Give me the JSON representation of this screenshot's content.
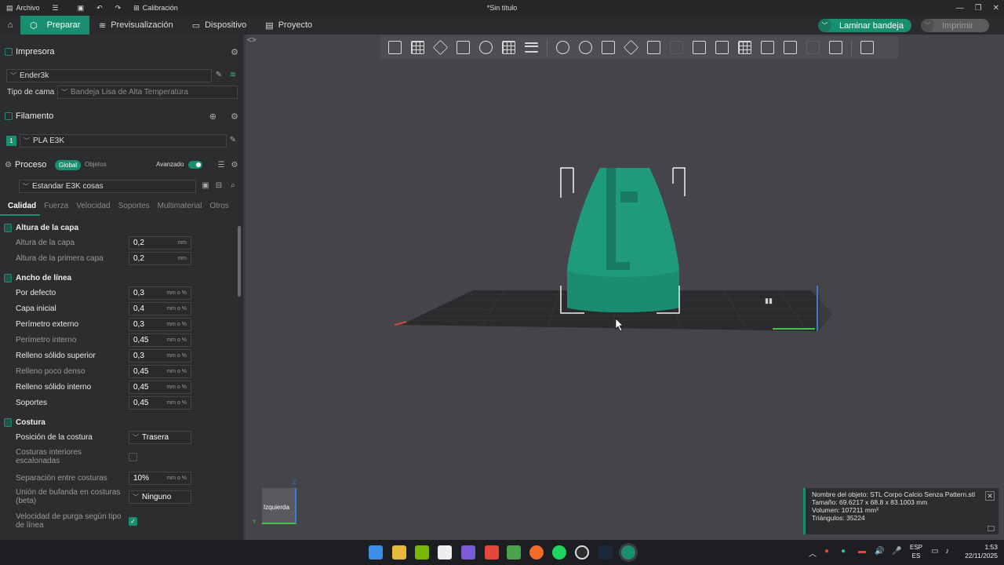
{
  "titlebar": {
    "menu_label": "Archivo",
    "calibration_label": "Calibración",
    "window_title": "*Sin título"
  },
  "nav": {
    "tabs": [
      {
        "label": "Preparar",
        "icon": "cube-icon",
        "active": true
      },
      {
        "label": "Previsualización",
        "icon": "layers-icon",
        "active": false
      },
      {
        "label": "Dispositivo",
        "icon": "monitor-icon",
        "active": false
      },
      {
        "label": "Proyecto",
        "icon": "document-icon",
        "active": false
      }
    ],
    "slice_button": "Laminar bandeja",
    "print_button": "Imprimir"
  },
  "printer": {
    "section_label": "Impresora",
    "printer_name": "Ender3k",
    "bed_type_label": "Tipo de cama",
    "bed_type_value": "Bandeja Lisa de Alta Temperatura"
  },
  "filament": {
    "section_label": "Filamento",
    "slot_number": "1",
    "filament_name": "PLA E3K"
  },
  "process": {
    "section_label": "Proceso",
    "global_label": "Global",
    "objects_label": "Objetos",
    "advanced_label": "Avanzado",
    "preset_name": "Estandar E3K cosas",
    "tabs": [
      "Calidad",
      "Fuerza",
      "Velocidad",
      "Soportes",
      "Multimaterial",
      "Otros"
    ]
  },
  "settings": {
    "groups": {
      "layer_height": "Altura de la capa",
      "line_width": "Ancho de línea",
      "seam": "Costura"
    },
    "layer_height": {
      "label": "Altura de la capa",
      "value": "0,2",
      "unit": "mm"
    },
    "first_layer_height": {
      "label": "Altura de la primera capa",
      "value": "0,2",
      "unit": "mm"
    },
    "line_default": {
      "label": "Por defecto",
      "value": "0,3",
      "unit": "mm o %"
    },
    "line_initial": {
      "label": "Capa inicial",
      "value": "0,4",
      "unit": "mm o %"
    },
    "line_outer": {
      "label": "Perímetro externo",
      "value": "0,3",
      "unit": "mm o %"
    },
    "line_inner": {
      "label": "Perímetro interno",
      "value": "0,45",
      "unit": "mm o %"
    },
    "line_top": {
      "label": "Relleno sólido superior",
      "value": "0,3",
      "unit": "mm o %"
    },
    "line_sparse": {
      "label": "Relleno poco denso",
      "value": "0,45",
      "unit": "mm o %"
    },
    "line_internal": {
      "label": "Relleno sólido interno",
      "value": "0,45",
      "unit": "mm o %"
    },
    "line_support": {
      "label": "Soportes",
      "value": "0,45",
      "unit": "mm o %"
    },
    "seam_position": {
      "label": "Posición de la costura",
      "value": "Trasera"
    },
    "staggered_seams": {
      "label": "Costuras interiores escalonadas",
      "checked": false
    },
    "seam_gap": {
      "label": "Separación entre costuras",
      "value": "10%",
      "unit": "mm o %"
    },
    "scarf_seam": {
      "label": "Unión de bufanda en costuras (beta)",
      "value": "Ninguno"
    },
    "wipe_speed": {
      "label": "Velocidad de purga según tipo de línea",
      "checked": true
    }
  },
  "viewport": {
    "view_cube_label": "Izquierda",
    "axis_z": "Z",
    "axis_y": "Y",
    "model_color": "#1f9b7c",
    "accent_color": "#1a8f70"
  },
  "info_panel": {
    "object_name": "Nombre del objeto: STL Corpo Calcio Senza Pattern.stl",
    "size": "Tamaño: 69.6217 x 68.8 x 83.1003 mm",
    "volume": "Volumen: 107211 mm³",
    "triangles": "Triángulos: 35224"
  },
  "taskbar": {
    "lang_top": "ESP",
    "lang_bottom": "ES",
    "time": "1:53",
    "date": "22/11/2025"
  }
}
